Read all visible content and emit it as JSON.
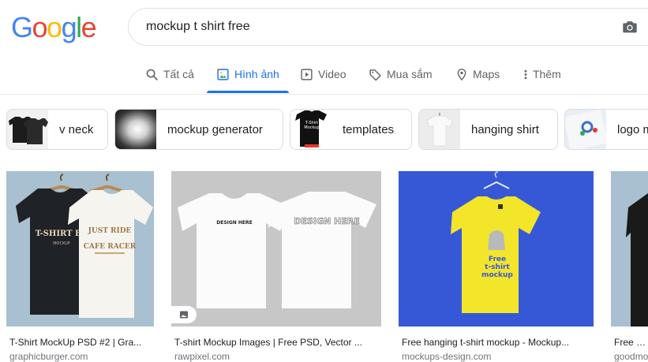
{
  "logo": {
    "letters": [
      "G",
      "o",
      "o",
      "g",
      "l",
      "e"
    ],
    "colors": [
      "#4285f4",
      "#ea4335",
      "#fbbc05",
      "#4285f4",
      "#34a853",
      "#ea4335"
    ]
  },
  "search": {
    "query": "mockup t shirt free"
  },
  "tabs": [
    {
      "label": "Tất cả",
      "icon": "search-icon"
    },
    {
      "label": "Hình ảnh",
      "icon": "image-icon"
    },
    {
      "label": "Video",
      "icon": "play-icon"
    },
    {
      "label": "Mua sắm",
      "icon": "tag-icon"
    },
    {
      "label": "Maps",
      "icon": "pin-icon"
    },
    {
      "label": "Thêm",
      "icon": "more-vert-icon"
    }
  ],
  "active_tab": "Hình ảnh",
  "accent_color": "#1a73e8",
  "chips": [
    {
      "label": "v neck"
    },
    {
      "label": "mockup generator"
    },
    {
      "label": "templates"
    },
    {
      "label": "hanging shirt"
    },
    {
      "label": "logo m"
    }
  ],
  "chip_thumb_text": {
    "templates_shirt_1": "T-Shirt",
    "templates_shirt_2": "Mockup"
  },
  "results": [
    {
      "title": "T-Shirt MockUp PSD #2 | Gra...",
      "source": "graphicburger.com",
      "shirt_text_1": "T-SHIRT BA",
      "shirt_text_2": "MOCKUP",
      "shirt_text_3": "JUST RIDE",
      "shirt_text_4": "CAFE RACER"
    },
    {
      "title": "T-shirt Mockup Images | Free PSD, Vector ...",
      "source": "rawpixel.com",
      "shirt_text_1": "DESIGN HERE",
      "shirt_text_2": "DESIGN HERE"
    },
    {
      "title": "Free hanging t-shirt mockup - Mockup...",
      "source": "mockups-design.com",
      "shirt_text_1": "Free",
      "shirt_text_2": "t-shirt",
      "shirt_text_3": "mockup"
    },
    {
      "title": "Free Bla",
      "source": "goodmo"
    }
  ]
}
